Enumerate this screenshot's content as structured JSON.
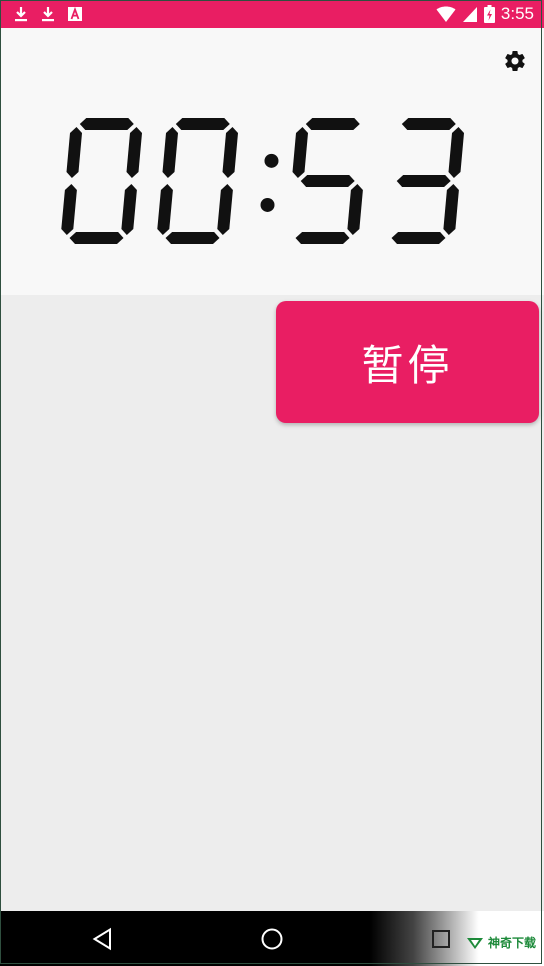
{
  "status_bar": {
    "time": "3:55",
    "icons": [
      "download-icon",
      "download-icon",
      "a-icon",
      "wifi-icon",
      "signal-icon",
      "battery-icon"
    ]
  },
  "timer": {
    "display": "00:53",
    "digit_color": "#111111"
  },
  "actions": {
    "pause_label": "暂停"
  },
  "nav": {
    "buttons": [
      "back-icon",
      "home-icon",
      "recents-icon"
    ]
  },
  "watermark": {
    "text": "神奇下载"
  },
  "colors": {
    "accent": "#e91e63",
    "panel": "#f8f8f8",
    "background": "#ededed"
  }
}
